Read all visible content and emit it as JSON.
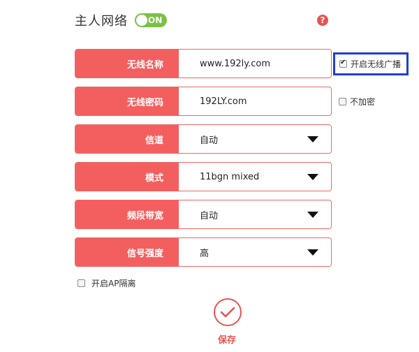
{
  "header": {
    "title": "主人网络",
    "toggle_label": "ON"
  },
  "help_icon_label": "?",
  "fields": {
    "ssid": {
      "label": "无线名称",
      "value": "www.192ly.com"
    },
    "password": {
      "label": "无线密码",
      "value": "192LY.com"
    },
    "channel": {
      "label": "信道",
      "value": "自动"
    },
    "mode": {
      "label": "模式",
      "value": "11bgn mixed"
    },
    "bandwidth": {
      "label": "频段带宽",
      "value": "自动"
    },
    "signal": {
      "label": "信号强度",
      "value": "高"
    }
  },
  "options": {
    "broadcast": {
      "label": "开启无线广播",
      "checked": true
    },
    "no_encryption": {
      "label": "不加密",
      "checked": false
    },
    "ap_isolation": {
      "label": "开启AP隔离",
      "checked": false
    }
  },
  "save_label": "保存",
  "colors": {
    "accent": "#f35f5f",
    "toggle_on": "#7ac143",
    "highlight_border": "#1f3fd0"
  }
}
